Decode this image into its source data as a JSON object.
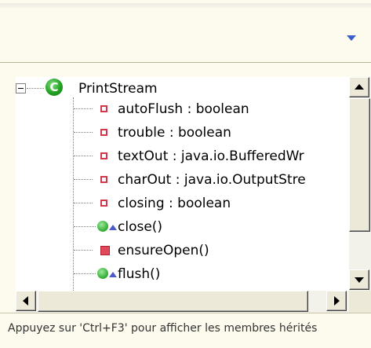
{
  "outline": {
    "root": {
      "name": "PrintStream",
      "icon": "class-icon",
      "class_letter": "C",
      "expanded": true
    },
    "members": [
      {
        "label": "autoFlush : boolean",
        "icon": "private-field-icon"
      },
      {
        "label": "trouble : boolean",
        "icon": "private-field-icon"
      },
      {
        "label": "textOut : java.io.BufferedWr",
        "icon": "private-field-icon"
      },
      {
        "label": "charOut : java.io.OutputStre",
        "icon": "private-field-icon"
      },
      {
        "label": "closing : boolean",
        "icon": "private-field-icon"
      },
      {
        "label": "close()",
        "icon": "public-method-override-icon"
      },
      {
        "label": "ensureOpen()",
        "icon": "private-method-icon"
      },
      {
        "label": "flush()",
        "icon": "public-method-override-icon"
      }
    ]
  },
  "status": {
    "hint": "Appuyez sur 'Ctrl+F3' pour afficher les membres hérités"
  },
  "colors": {
    "background": "#fdfbed",
    "field": "#d0384c",
    "method_public": "#3cb43c",
    "override": "#4a5ac8"
  }
}
